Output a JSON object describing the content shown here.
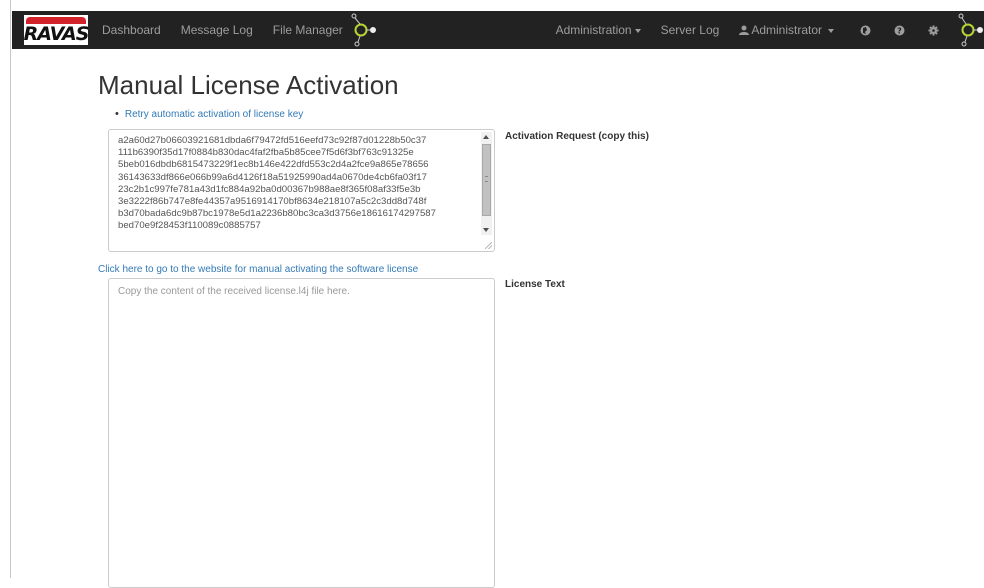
{
  "navbar": {
    "logo_text": "RAVAS",
    "links": [
      "Dashboard",
      "Message Log",
      "File Manager"
    ],
    "right": {
      "administration": "Administration",
      "server_log": "Server Log",
      "user": "Administrator"
    },
    "icons": [
      "network-nodes-icon",
      "globe-icon",
      "help-icon",
      "gear-icon",
      "network-nodes-icon"
    ],
    "colors": {
      "bar": "#222222",
      "text": "#9d9d9d",
      "accent_green": "#b7d433",
      "logo_red": "#d2232a"
    }
  },
  "page": {
    "title": "Manual License Activation",
    "retry_link": "Retry automatic activation of license key",
    "activation_request": {
      "label": "Activation Request (copy this)",
      "lines": [
        "a2a60d27b06603921681dbda6f79472fd516eefd73c92f87d01228b50c37",
        "111b6390f35d17f0884b830dac4faf2fba5b85cee7f5d6f3bf763c91325e",
        "5beb016dbdb6815473229f1ec8b146e422dfd553c2d4a2fce9a865e78656",
        "36143633df866e066b99a6d4126f18a51925990ad4a0670de4cb6fa03f17",
        "23c2b1c997fe781a43d1fc884a92ba0d00367b988ae8f365f08af33f5e3b",
        "3e3222f86b747e8fe44357a9516914170bf8634e218107a5c2c3dd8d748f",
        "b3d70bada6dc9b87bc1978e5d1a2236b80bc3ca3d3756e18616174297587",
        "bed70e9f28453f110089c0885757"
      ]
    },
    "manual_link": "Click here to go to the website for manual activating the software license",
    "license": {
      "label": "License Text",
      "placeholder": "Copy the content of the received license.l4j file here.",
      "value": ""
    },
    "link_color": "#337ab7"
  }
}
